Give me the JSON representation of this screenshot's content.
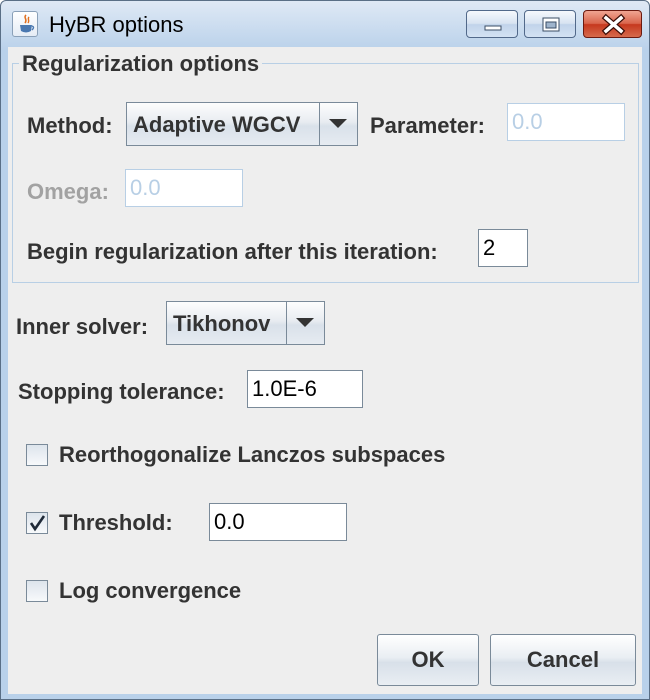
{
  "window": {
    "title": "HyBR options",
    "controls": {
      "minimize": "minimize-icon",
      "maximize": "maximize-icon",
      "close": "close-icon"
    }
  },
  "regularization": {
    "group_title": "Regularization options",
    "method_label": "Method:",
    "method_value": "Adaptive WGCV",
    "parameter_label": "Parameter:",
    "parameter_value": "0.0",
    "omega_label": "Omega:",
    "omega_value": "0.0",
    "begin_label": "Begin regularization after this iteration:",
    "begin_value": "2"
  },
  "inner_solver": {
    "label": "Inner solver:",
    "value": "Tikhonov"
  },
  "stopping": {
    "label": "Stopping tolerance:",
    "value": "1.0E-6"
  },
  "reorth": {
    "label": "Reorthogonalize Lanczos subspaces",
    "checked": false
  },
  "threshold": {
    "label": "Threshold:",
    "checked": true,
    "value": "0.0"
  },
  "log": {
    "label": "Log convergence",
    "checked": false
  },
  "buttons": {
    "ok": "OK",
    "cancel": "Cancel"
  },
  "colors": {
    "disabled_text": "#b8cfe5",
    "label_text": "#333333",
    "title_bar": "#b9d1ea",
    "close_button": "#c6381e"
  }
}
